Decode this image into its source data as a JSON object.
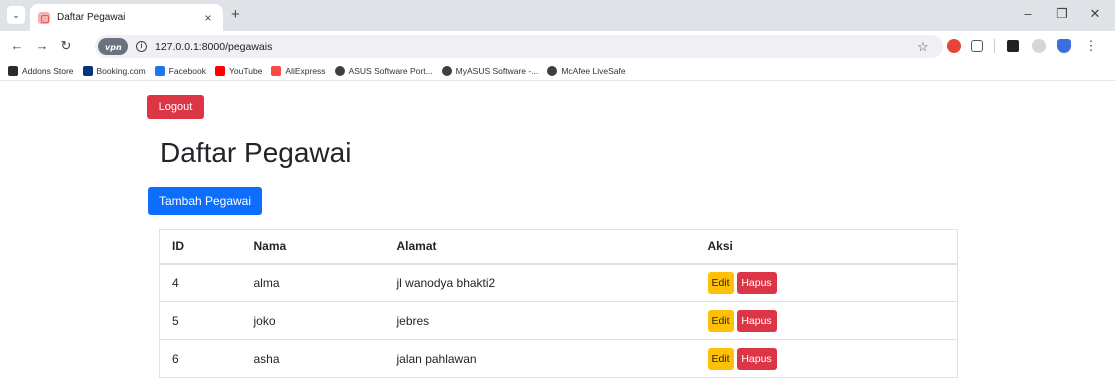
{
  "browser": {
    "tab_title": "Daftar Pegawai",
    "tab_close": "×",
    "new_tab": "+",
    "url": "127.0.0.1:8000/pegawais",
    "vpn_label": "VPN"
  },
  "bookmarks": [
    {
      "label": "Addons Store",
      "icon": "addons-icon",
      "color": "#2b2b2b"
    },
    {
      "label": "Booking.com",
      "icon": "booking-icon",
      "color": "#003580"
    },
    {
      "label": "Facebook",
      "icon": "facebook-icon",
      "color": "#1877f2"
    },
    {
      "label": "YouTube",
      "icon": "youtube-icon",
      "color": "#ff0000"
    },
    {
      "label": "AliExpress",
      "icon": "aliexpress-icon",
      "color": "#ff4747"
    },
    {
      "label": "ASUS Software Port...",
      "icon": "globe-icon",
      "color": "#3c4043"
    },
    {
      "label": "MyASUS Software -...",
      "icon": "globe-icon",
      "color": "#3c4043"
    },
    {
      "label": "McAfee LiveSafe",
      "icon": "globe-icon",
      "color": "#3c4043"
    }
  ],
  "page": {
    "logout_label": "Logout",
    "title": "Daftar Pegawai",
    "add_label": "Tambah Pegawai"
  },
  "table": {
    "headers": [
      "ID",
      "Nama",
      "Alamat",
      "Aksi"
    ],
    "rows": [
      {
        "id": "4",
        "nama": "alma",
        "alamat": "jl wanodya bhakti2"
      },
      {
        "id": "5",
        "nama": "joko",
        "alamat": "jebres"
      },
      {
        "id": "6",
        "nama": "asha",
        "alamat": "jalan pahlawan"
      }
    ],
    "edit_label": "Edit",
    "delete_label": "Hapus"
  },
  "colors": {
    "danger": "#dc3545",
    "primary": "#0d6efd",
    "warning": "#ffc107"
  }
}
